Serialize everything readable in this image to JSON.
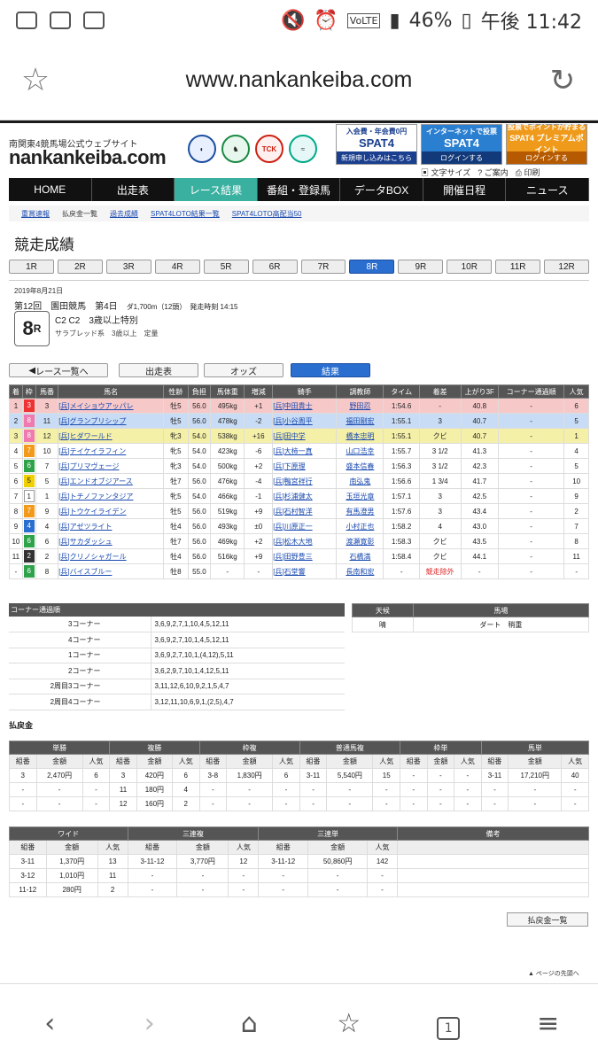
{
  "status_bar": {
    "battery": "46%",
    "time": "午後 11:42"
  },
  "browser": {
    "url": "www.nankankeiba.com"
  },
  "site": {
    "tagline": "南関東4競馬場公式ウェブサイト",
    "logo": "nankankeiba.com",
    "spat1_top": "入会費・年会費0円",
    "spat1_name": "SPAT4",
    "spat1_bottom": "新規申し込みはこちら",
    "spat2_top": "インターネットで投票",
    "spat2_name": "SPAT4",
    "spat2_bottom": "ログインする",
    "spat3_top": "投票でポイントが貯まる",
    "spat3_name": "SPAT4 プレミアムポイント",
    "spat3_bottom": "ログインする",
    "font_size": "文字サイズ",
    "guide": "ご案内",
    "print": "印刷"
  },
  "nav": [
    "HOME",
    "出走表",
    "レース結果",
    "番組・登録馬",
    "データBOX",
    "開催日程",
    "ニュース"
  ],
  "subnav": [
    "重賞速報",
    "払戻金一覧",
    "過去成績",
    "SPAT4LOTO結果一覧",
    "SPAT4LOTO高配当50"
  ],
  "page_title": "競走成績",
  "race_tabs": [
    "1R",
    "2R",
    "3R",
    "4R",
    "5R",
    "6R",
    "7R",
    "8R",
    "9R",
    "10R",
    "11R",
    "12R"
  ],
  "race": {
    "date": "2019年8月21日",
    "meeting": "第12回　園田競馬　第4日",
    "course": "ダ1,700m（12頭）　発走時刻 14:15",
    "num": "8",
    "r": "R",
    "class": "C2 C2　3歳以上特別",
    "sub": "サラブレッド系　3歳以上　定量"
  },
  "actions": {
    "back": "レース一覧へ",
    "entries": "出走表",
    "odds": "オッズ",
    "result": "結果"
  },
  "results_headers": [
    "着",
    "枠",
    "馬番",
    "馬名",
    "性齢",
    "負担",
    "馬体重",
    "増減",
    "騎手",
    "調教師",
    "タイム",
    "着差",
    "上がり3F",
    "コーナー通過順",
    "人気"
  ],
  "results": [
    [
      "1",
      "3",
      "3",
      "[兵]メイショウアッパレ",
      "牡5",
      "56.0",
      "495kg",
      "+1",
      "[兵]中田貴士",
      "野田忍",
      "1:54.6",
      "-",
      "40.8",
      "-",
      "6"
    ],
    [
      "2",
      "8",
      "11",
      "[兵]グランプリシップ",
      "牡5",
      "56.0",
      "478kg",
      "-2",
      "[兵]小谷周平",
      "福田剛宏",
      "1:55.1",
      "3",
      "40.7",
      "-",
      "5"
    ],
    [
      "3",
      "8",
      "12",
      "[兵]ヒダワールド",
      "牝3",
      "54.0",
      "538kg",
      "+16",
      "[兵]田中学",
      "橋本忠明",
      "1:55.1",
      "クビ",
      "40.7",
      "-",
      "1"
    ],
    [
      "4",
      "7",
      "10",
      "[兵]テイケイラフィン",
      "牝5",
      "54.0",
      "423kg",
      "-6",
      "[兵]大柿一真",
      "山口浩幸",
      "1:55.7",
      "3 1/2",
      "41.3",
      "-",
      "4"
    ],
    [
      "5",
      "6",
      "7",
      "[兵]プリマヴェージ",
      "牝3",
      "54.0",
      "500kg",
      "+2",
      "[兵]下原理",
      "盛本信春",
      "1:56.3",
      "3 1/2",
      "42.3",
      "-",
      "5"
    ],
    [
      "6",
      "5",
      "5",
      "[兵]エンドオブジアース",
      "牡7",
      "56.0",
      "476kg",
      "-4",
      "[兵]鴨宮祥行",
      "南弘鬼",
      "1:56.6",
      "1 3/4",
      "41.7",
      "-",
      "10"
    ],
    [
      "7",
      "1",
      "1",
      "[兵]トチノファンタジア",
      "牝5",
      "54.0",
      "466kg",
      "-1",
      "[兵]杉浦健太",
      "玉垣光章",
      "1:57.1",
      "3",
      "42.5",
      "-",
      "9"
    ],
    [
      "8",
      "7",
      "9",
      "[兵]トウケイライデン",
      "牡5",
      "56.0",
      "519kg",
      "+9",
      "[兵]石村智洋",
      "有馬澄男",
      "1:57.6",
      "3",
      "43.4",
      "-",
      "2"
    ],
    [
      "9",
      "4",
      "4",
      "[兵]アゼツライト",
      "牡4",
      "56.0",
      "493kg",
      "±0",
      "[兵]川原正一",
      "小村正也",
      "1:58.2",
      "4",
      "43.0",
      "-",
      "7"
    ],
    [
      "10",
      "6",
      "6",
      "[兵]サカダッシュ",
      "牡7",
      "56.0",
      "469kg",
      "+2",
      "[兵]松木大地",
      "渡瀬寛彰",
      "1:58.3",
      "クビ",
      "43.5",
      "-",
      "8"
    ],
    [
      "11",
      "2",
      "2",
      "[兵]クリノシャガール",
      "牡4",
      "56.0",
      "516kg",
      "+9",
      "[兵]田野豊三",
      "石橋満",
      "1:58.4",
      "クビ",
      "44.1",
      "-",
      "11"
    ],
    [
      "-",
      "6",
      "8",
      "[兵]バイスブルー",
      "牡8",
      "55.0",
      "-",
      "-",
      "[兵]石堂響",
      "長南和宏",
      "-",
      "競走除外",
      "-",
      "-",
      "-"
    ]
  ],
  "corner": {
    "title": "コーナー通過順",
    "rows": [
      [
        "3コーナー",
        "3,6,9,2,7,1,10,4,5,12,11"
      ],
      [
        "4コーナー",
        "3,6,9,2,7,10,1,4,5,12,11"
      ],
      [
        "1コーナー",
        "3,6,9,2,7,10,1,(4,12),5,11"
      ],
      [
        "2コーナー",
        "3,6,2,9,7,10,1,4,12,5,11"
      ],
      [
        "2周目3コーナー",
        "3,11,12,6,10,9,2,1,5,4,7"
      ],
      [
        "2周目4コーナー",
        "3,12,11,10,6,9,1,(2,5),4,7"
      ]
    ]
  },
  "weather": {
    "h1": "天候",
    "h2": "馬場",
    "v1": "晴",
    "v2": "ダート　稍重"
  },
  "payout_title": "払戻金",
  "pay1_headers": [
    "単勝",
    "複勝",
    "枠複",
    "普通馬複",
    "枠単",
    "馬単"
  ],
  "pay_sub": [
    "組番",
    "金額",
    "人気"
  ],
  "pay1_rows": [
    [
      "3",
      "2,470円",
      "6",
      "3",
      "420円",
      "6",
      "3-8",
      "1,830円",
      "6",
      "3-11",
      "5,540円",
      "15",
      "-",
      "-",
      "-",
      "3-11",
      "17,210円",
      "40"
    ],
    [
      "-",
      "-",
      "-",
      "11",
      "180円",
      "4",
      "-",
      "-",
      "-",
      "-",
      "-",
      "-",
      "-",
      "-",
      "-",
      "-",
      "-",
      "-"
    ],
    [
      "-",
      "-",
      "-",
      "12",
      "160円",
      "2",
      "-",
      "-",
      "-",
      "-",
      "-",
      "-",
      "-",
      "-",
      "-",
      "-",
      "-",
      "-"
    ]
  ],
  "pay2_headers": [
    "ワイド",
    "三連複",
    "三連単",
    "備考"
  ],
  "pay2_rows": [
    [
      "3-11",
      "1,370円",
      "13",
      "3-11-12",
      "3,770円",
      "12",
      "3-11-12",
      "50,860円",
      "142",
      ""
    ],
    [
      "3-12",
      "1,010円",
      "11",
      "-",
      "-",
      "-",
      "-",
      "-",
      "-",
      ""
    ],
    [
      "11-12",
      "280円",
      "2",
      "-",
      "-",
      "-",
      "-",
      "-",
      "-",
      ""
    ]
  ],
  "pay_all": "払戻金一覧",
  "page_top": "ページの先頭へ",
  "waku_colors": {
    "1": "#ffffff",
    "2": "#333333",
    "3": "#e33",
    "4": "#2a6ed0",
    "5": "#f0d000",
    "6": "#2fa34a",
    "7": "#f39a1a",
    "8": "#f07ab0"
  },
  "row_highlight": {
    "1": "#f7c8c8",
    "2": "#c8dcf5",
    "3": "#f5f0a8"
  }
}
